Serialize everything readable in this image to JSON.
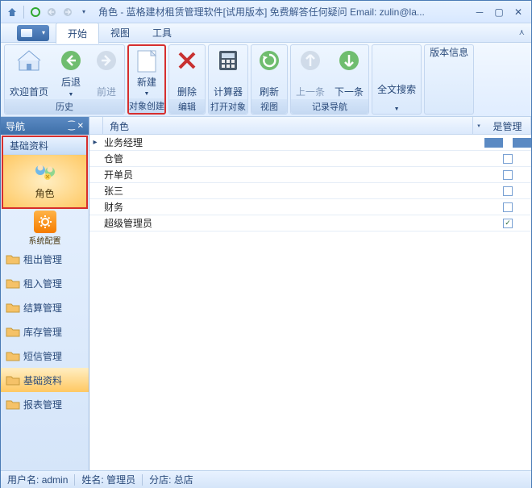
{
  "title": "角色 - 蓝格建材租赁管理软件[试用版本] 免费解答任何疑问 Email: zulin@la...",
  "menu": {
    "tabs": [
      "开始",
      "视图",
      "工具"
    ],
    "active": 0
  },
  "ribbon": {
    "groups": [
      {
        "label": "历史",
        "buttons": [
          {
            "label": "欢迎首页",
            "icon": "home"
          },
          {
            "label": "后退",
            "icon": "back",
            "drop": true
          },
          {
            "label": "前进",
            "icon": "forward",
            "disabled": true
          }
        ]
      },
      {
        "label": "对象创建",
        "highlight": true,
        "buttons": [
          {
            "label": "新建",
            "icon": "new",
            "drop": true
          }
        ]
      },
      {
        "label": "编辑",
        "buttons": [
          {
            "label": "删除",
            "icon": "delete"
          }
        ]
      },
      {
        "label": "打开对象",
        "buttons": [
          {
            "label": "计算器",
            "icon": "calc"
          }
        ]
      },
      {
        "label": "视图",
        "buttons": [
          {
            "label": "刷新",
            "icon": "refresh"
          }
        ]
      },
      {
        "label": "记录导航",
        "buttons": [
          {
            "label": "上一条",
            "icon": "prev",
            "disabled": true
          },
          {
            "label": "下一条",
            "icon": "next"
          }
        ]
      },
      {
        "label": "",
        "buttons": [
          {
            "label": "全文搜索",
            "icon": "search",
            "drop": true
          }
        ]
      },
      {
        "label": "",
        "buttons": [
          {
            "label": "版本信息",
            "icon": "",
            "noicon": true
          }
        ]
      }
    ]
  },
  "nav": {
    "title": "导航",
    "section_head": "基础资料",
    "big_item": "角色",
    "gear_item": "系统配置",
    "items": [
      "租出管理",
      "租入管理",
      "结算管理",
      "库存管理",
      "短信管理",
      "基础资料",
      "报表管理"
    ],
    "active_index": 5
  },
  "grid": {
    "cols": {
      "role": "角色",
      "admin": "是管理员"
    },
    "rows": [
      {
        "role": "业务经理",
        "admin": false,
        "selected": true
      },
      {
        "role": "仓管",
        "admin": false
      },
      {
        "role": "开单员",
        "admin": false
      },
      {
        "role": "张三",
        "admin": false
      },
      {
        "role": "财务",
        "admin": false
      },
      {
        "role": "超级管理员",
        "admin": true
      }
    ]
  },
  "status": {
    "user_label": "用户名:",
    "user": "admin",
    "name_label": "姓名:",
    "name": "管理员",
    "branch_label": "分店:",
    "branch": "总店"
  }
}
